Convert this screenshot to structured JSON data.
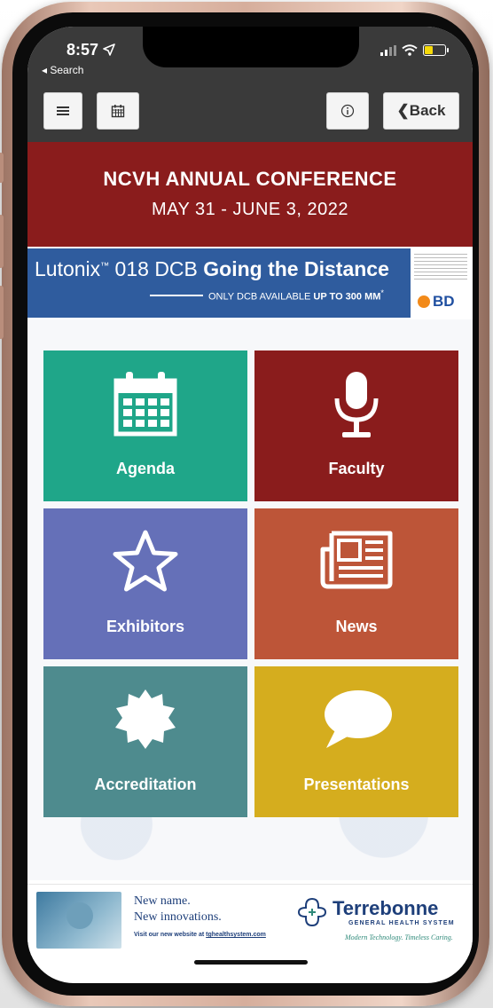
{
  "status_bar": {
    "time": "8:57",
    "back_app": "◂ Search"
  },
  "toolbar": {
    "menu_icon": "hamburger-icon",
    "calendar_icon": "calendar-icon",
    "info_icon": "info-icon",
    "back_label": "❮Back"
  },
  "header": {
    "title": "NCVH ANNUAL CONFERENCE",
    "dates": "MAY 31 - JUNE 3, 2022"
  },
  "ad_top": {
    "brand": "Lutonix",
    "tm": "™",
    "model": " 018 DCB ",
    "headline": "Going the Distance",
    "subline_prefix": "ONLY DCB AVAILABLE ",
    "subline_bold": "UP TO 300 MM",
    "subline_mark": "*",
    "logo_text": "BD"
  },
  "tiles": [
    {
      "label": "Agenda",
      "icon": "calendar-icon",
      "color": "#1fa689"
    },
    {
      "label": "Faculty",
      "icon": "microphone-icon",
      "color": "#8a1c1c"
    },
    {
      "label": "Exhibitors",
      "icon": "star-icon",
      "color": "#6570b8"
    },
    {
      "label": "News",
      "icon": "newspaper-icon",
      "color": "#bd5538"
    },
    {
      "label": "Accreditation",
      "icon": "badge-icon",
      "color": "#4e8b8e"
    },
    {
      "label": "Presentations",
      "icon": "speech-bubble-icon",
      "color": "#d5ad1e"
    }
  ],
  "ad_bottom": {
    "line1": "New name.",
    "line2": "New innovations.",
    "url_prefix": "Visit our new website at ",
    "url": "tghealthsystem.com",
    "brand": "Terrebonne",
    "brand_sub": "GENERAL HEALTH SYSTEM",
    "tagline": "Modern Technology. Timeless Caring."
  }
}
